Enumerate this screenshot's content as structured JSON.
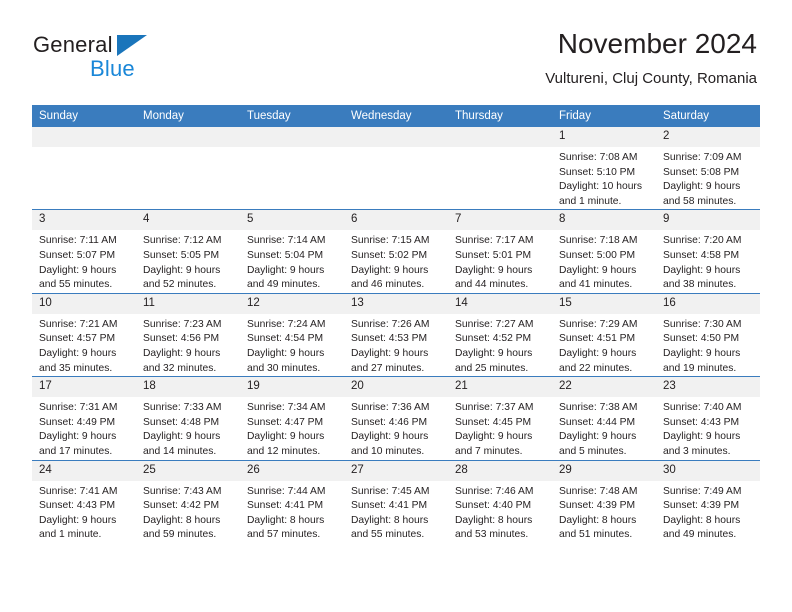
{
  "brand": {
    "name_part1": "General",
    "name_part2": "Blue",
    "accent_color": "#1a75bb",
    "logo_icon": "triangle-logo-icon"
  },
  "header": {
    "title": "November 2024",
    "subtitle": "Vultureni, Cluj County, Romania"
  },
  "theme": {
    "header_blue": "#3a7cbe",
    "daynum_gray": "#f1f1f1",
    "text": "#231f20"
  },
  "calendar": {
    "weekday_headers": [
      "Sunday",
      "Monday",
      "Tuesday",
      "Wednesday",
      "Thursday",
      "Friday",
      "Saturday"
    ],
    "weeks": [
      [
        {
          "day": "",
          "empty": true
        },
        {
          "day": "",
          "empty": true
        },
        {
          "day": "",
          "empty": true
        },
        {
          "day": "",
          "empty": true
        },
        {
          "day": "",
          "empty": true
        },
        {
          "day": "1",
          "sunrise": "Sunrise: 7:08 AM",
          "sunset": "Sunset: 5:10 PM",
          "daylight": "Daylight: 10 hours and 1 minute."
        },
        {
          "day": "2",
          "sunrise": "Sunrise: 7:09 AM",
          "sunset": "Sunset: 5:08 PM",
          "daylight": "Daylight: 9 hours and 58 minutes."
        }
      ],
      [
        {
          "day": "3",
          "sunrise": "Sunrise: 7:11 AM",
          "sunset": "Sunset: 5:07 PM",
          "daylight": "Daylight: 9 hours and 55 minutes."
        },
        {
          "day": "4",
          "sunrise": "Sunrise: 7:12 AM",
          "sunset": "Sunset: 5:05 PM",
          "daylight": "Daylight: 9 hours and 52 minutes."
        },
        {
          "day": "5",
          "sunrise": "Sunrise: 7:14 AM",
          "sunset": "Sunset: 5:04 PM",
          "daylight": "Daylight: 9 hours and 49 minutes."
        },
        {
          "day": "6",
          "sunrise": "Sunrise: 7:15 AM",
          "sunset": "Sunset: 5:02 PM",
          "daylight": "Daylight: 9 hours and 46 minutes."
        },
        {
          "day": "7",
          "sunrise": "Sunrise: 7:17 AM",
          "sunset": "Sunset: 5:01 PM",
          "daylight": "Daylight: 9 hours and 44 minutes."
        },
        {
          "day": "8",
          "sunrise": "Sunrise: 7:18 AM",
          "sunset": "Sunset: 5:00 PM",
          "daylight": "Daylight: 9 hours and 41 minutes."
        },
        {
          "day": "9",
          "sunrise": "Sunrise: 7:20 AM",
          "sunset": "Sunset: 4:58 PM",
          "daylight": "Daylight: 9 hours and 38 minutes."
        }
      ],
      [
        {
          "day": "10",
          "sunrise": "Sunrise: 7:21 AM",
          "sunset": "Sunset: 4:57 PM",
          "daylight": "Daylight: 9 hours and 35 minutes."
        },
        {
          "day": "11",
          "sunrise": "Sunrise: 7:23 AM",
          "sunset": "Sunset: 4:56 PM",
          "daylight": "Daylight: 9 hours and 32 minutes."
        },
        {
          "day": "12",
          "sunrise": "Sunrise: 7:24 AM",
          "sunset": "Sunset: 4:54 PM",
          "daylight": "Daylight: 9 hours and 30 minutes."
        },
        {
          "day": "13",
          "sunrise": "Sunrise: 7:26 AM",
          "sunset": "Sunset: 4:53 PM",
          "daylight": "Daylight: 9 hours and 27 minutes."
        },
        {
          "day": "14",
          "sunrise": "Sunrise: 7:27 AM",
          "sunset": "Sunset: 4:52 PM",
          "daylight": "Daylight: 9 hours and 25 minutes."
        },
        {
          "day": "15",
          "sunrise": "Sunrise: 7:29 AM",
          "sunset": "Sunset: 4:51 PM",
          "daylight": "Daylight: 9 hours and 22 minutes."
        },
        {
          "day": "16",
          "sunrise": "Sunrise: 7:30 AM",
          "sunset": "Sunset: 4:50 PM",
          "daylight": "Daylight: 9 hours and 19 minutes."
        }
      ],
      [
        {
          "day": "17",
          "sunrise": "Sunrise: 7:31 AM",
          "sunset": "Sunset: 4:49 PM",
          "daylight": "Daylight: 9 hours and 17 minutes."
        },
        {
          "day": "18",
          "sunrise": "Sunrise: 7:33 AM",
          "sunset": "Sunset: 4:48 PM",
          "daylight": "Daylight: 9 hours and 14 minutes."
        },
        {
          "day": "19",
          "sunrise": "Sunrise: 7:34 AM",
          "sunset": "Sunset: 4:47 PM",
          "daylight": "Daylight: 9 hours and 12 minutes."
        },
        {
          "day": "20",
          "sunrise": "Sunrise: 7:36 AM",
          "sunset": "Sunset: 4:46 PM",
          "daylight": "Daylight: 9 hours and 10 minutes."
        },
        {
          "day": "21",
          "sunrise": "Sunrise: 7:37 AM",
          "sunset": "Sunset: 4:45 PM",
          "daylight": "Daylight: 9 hours and 7 minutes."
        },
        {
          "day": "22",
          "sunrise": "Sunrise: 7:38 AM",
          "sunset": "Sunset: 4:44 PM",
          "daylight": "Daylight: 9 hours and 5 minutes."
        },
        {
          "day": "23",
          "sunrise": "Sunrise: 7:40 AM",
          "sunset": "Sunset: 4:43 PM",
          "daylight": "Daylight: 9 hours and 3 minutes."
        }
      ],
      [
        {
          "day": "24",
          "sunrise": "Sunrise: 7:41 AM",
          "sunset": "Sunset: 4:43 PM",
          "daylight": "Daylight: 9 hours and 1 minute."
        },
        {
          "day": "25",
          "sunrise": "Sunrise: 7:43 AM",
          "sunset": "Sunset: 4:42 PM",
          "daylight": "Daylight: 8 hours and 59 minutes."
        },
        {
          "day": "26",
          "sunrise": "Sunrise: 7:44 AM",
          "sunset": "Sunset: 4:41 PM",
          "daylight": "Daylight: 8 hours and 57 minutes."
        },
        {
          "day": "27",
          "sunrise": "Sunrise: 7:45 AM",
          "sunset": "Sunset: 4:41 PM",
          "daylight": "Daylight: 8 hours and 55 minutes."
        },
        {
          "day": "28",
          "sunrise": "Sunrise: 7:46 AM",
          "sunset": "Sunset: 4:40 PM",
          "daylight": "Daylight: 8 hours and 53 minutes."
        },
        {
          "day": "29",
          "sunrise": "Sunrise: 7:48 AM",
          "sunset": "Sunset: 4:39 PM",
          "daylight": "Daylight: 8 hours and 51 minutes."
        },
        {
          "day": "30",
          "sunrise": "Sunrise: 7:49 AM",
          "sunset": "Sunset: 4:39 PM",
          "daylight": "Daylight: 8 hours and 49 minutes."
        }
      ]
    ]
  }
}
